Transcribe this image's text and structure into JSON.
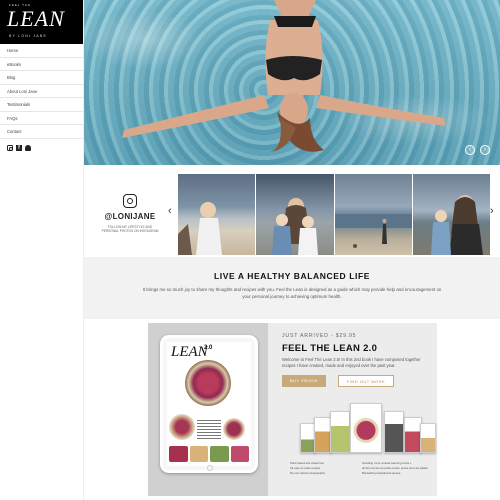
{
  "brand": {
    "tagline": "FEEL THE",
    "name": "LEAN",
    "byline": "BY LONI JANE"
  },
  "nav": {
    "items": [
      "Home",
      "eBooks",
      "Blog",
      "About Loni Jane",
      "Testimonials",
      "FAQs",
      "Contact"
    ]
  },
  "social": {
    "icons": [
      "instagram-icon",
      "facebook-icon",
      "snapchat-icon"
    ]
  },
  "hero": {
    "prev": "‹",
    "next": "›"
  },
  "instagram": {
    "handle": "@LONIJANE",
    "caption": "FOLLOW MY LIFESTYLE AND PERSONAL PHOTOS ON INSTAGRAM",
    "prev": "‹",
    "next": "›"
  },
  "healthy": {
    "heading": "LIVE A HEALTHY BALANCED LIFE",
    "text": "It brings me so much joy to share my thoughts and recipes with you. Feel the Lean is designed as a guide which may provide help and encouragement on your personal journey to achieving optimum health."
  },
  "promo": {
    "label": "JUST ARRIVED - $29.95",
    "title": "FEEL THE LEAN 2.0",
    "description": "Welcome to Feel The Lean 2.0! In this 2nd book I have composed together recipes I have created, made and enjoyed over the past year.",
    "buy_label": "BUY EBOOK",
    "more_label": "FIND OUT MORE",
    "tablet_title": "LEAN",
    "tablet_version": "2.0",
    "features": [
      "Plant based and wheat free",
      "Including more cooked warming foods +",
      "All easy to make recipes",
      "all fat promise smoothie bowls, juices and raw salads",
      "My own vibrant photography",
      "Bestselling inspirational quotes"
    ]
  },
  "colors": {
    "accent": "#c7aa7a",
    "sidebar_header": "#000000",
    "section_bg": "#f2f2f2",
    "pool": "#7bbfcf"
  }
}
